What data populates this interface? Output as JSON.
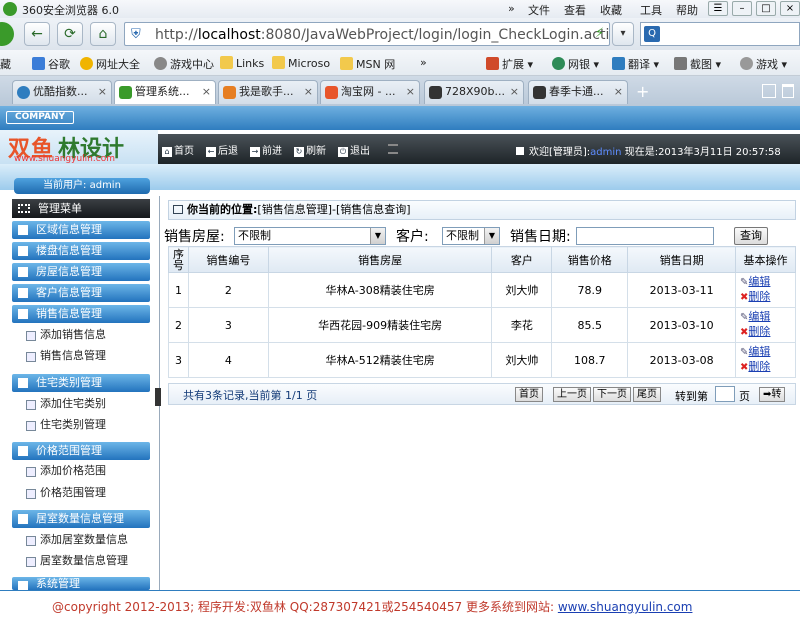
{
  "browser": {
    "title": "360安全浏览器 6.0",
    "menu": [
      "文件",
      "查看",
      "收藏",
      "工具",
      "帮助"
    ],
    "url": "http://localhost:8080/JavaWebProject/login/login_CheckLogin.acti",
    "url_host": "localhost",
    "url_before_host": "http://",
    "url_after_host": ":8080/JavaWebProject/login/login_CheckLogin.acti",
    "favorites_left": [
      "藏",
      "谷歌",
      "网址大全",
      "游戏中心",
      "Links",
      "Microso",
      "MSN 网"
    ],
    "favorites_right": [
      "扩展",
      "网银",
      "翻译",
      "截图",
      "游戏"
    ],
    "tabs": [
      {
        "label": "优酷指数..."
      },
      {
        "label": "管理系统..."
      },
      {
        "label": "我是歌手..."
      },
      {
        "label": "淘宝网 - ..."
      },
      {
        "label": "728X90b..."
      },
      {
        "label": "春季卡通..."
      }
    ],
    "new_tab": "+"
  },
  "header": {
    "company": "COMPANY",
    "logo_text1": "双鱼",
    "logo_text2": "林设计",
    "logo_url": "www.shuangyulin.com",
    "buttons": [
      "首页",
      "后退",
      "前进",
      "刷新",
      "退出"
    ],
    "welcome_prefix": "欢迎[管理员]:",
    "welcome_user": "admin",
    "welcome_suffix": "现在是:2013年3月11日 20:57:58"
  },
  "sidebar": {
    "current_user": "当前用户: admin",
    "menu_title": "管理菜单",
    "sections": [
      {
        "label": "区域信息管理",
        "items": []
      },
      {
        "label": "楼盘信息管理",
        "items": []
      },
      {
        "label": "房屋信息管理",
        "items": []
      },
      {
        "label": "客户信息管理",
        "items": []
      },
      {
        "label": "销售信息管理",
        "items": [
          "添加销售信息",
          "销售信息管理"
        ]
      },
      {
        "label": "住宅类别管理",
        "items": [
          "添加住宅类别",
          "住宅类别管理"
        ]
      },
      {
        "label": "价格范围管理",
        "items": [
          "添加价格范围",
          "价格范围管理"
        ]
      },
      {
        "label": "居室数量信息管理",
        "items": [
          "添加居室数量信息",
          "居室数量信息管理"
        ]
      },
      {
        "label": "系统管理",
        "items": []
      }
    ]
  },
  "breadcrumb": {
    "label": "你当前的位置:",
    "path": "[销售信息管理]-[销售信息查询]"
  },
  "filter": {
    "house_label": "销售房屋:",
    "house_value": "不限制",
    "customer_label": "客户:",
    "customer_value": "不限制",
    "date_label": "销售日期:",
    "date_value": "",
    "query_button": "查询"
  },
  "table": {
    "columns": [
      "序号",
      "销售编号",
      "销售房屋",
      "客户",
      "销售价格",
      "销售日期",
      "基本操作"
    ],
    "rows": [
      {
        "index": "1",
        "id": "2",
        "house": "华林A-308精装住宅房",
        "customer": "刘大帅",
        "price": "78.9",
        "date": "2013-03-11"
      },
      {
        "index": "2",
        "id": "3",
        "house": "华西花园-909精装住宅房",
        "customer": "李花",
        "price": "85.5",
        "date": "2013-03-10"
      },
      {
        "index": "3",
        "id": "4",
        "house": "华林A-512精装住宅房",
        "customer": "刘大帅",
        "price": "108.7",
        "date": "2013-03-08"
      }
    ],
    "edit_label": "编辑",
    "delete_label": "删除"
  },
  "pager": {
    "info": "共有3条记录,当前第 1/1 页",
    "first": "首页",
    "prev": "上一页",
    "next": "下一页",
    "last": "尾页",
    "goto_label": "转到第",
    "page_label": "页",
    "go_button": "转"
  },
  "footer": {
    "text": "@copyright 2012-2013; 程序开发:双鱼林  QQ:287307421或254540457  更多系统到网站: ",
    "link": "www.shuangyulin.com"
  }
}
